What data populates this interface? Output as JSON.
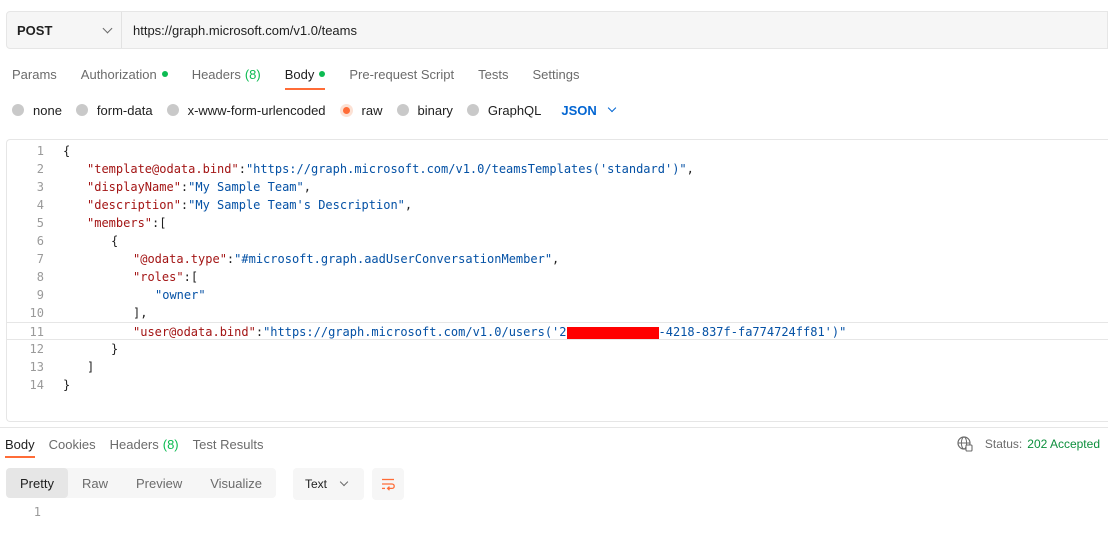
{
  "request": {
    "method": "POST",
    "url": "https://graph.microsoft.com/v1.0/teams"
  },
  "request_tabs": [
    {
      "label": "Params",
      "count": "",
      "dot": false,
      "active": false
    },
    {
      "label": "Authorization",
      "count": "",
      "dot": true,
      "active": false
    },
    {
      "label": "Headers",
      "count": "(8)",
      "dot": false,
      "active": false
    },
    {
      "label": "Body",
      "count": "",
      "dot": true,
      "active": true
    },
    {
      "label": "Pre-request Script",
      "count": "",
      "dot": false,
      "active": false
    },
    {
      "label": "Tests",
      "count": "",
      "dot": false,
      "active": false
    },
    {
      "label": "Settings",
      "count": "",
      "dot": false,
      "active": false
    }
  ],
  "body_types": {
    "options": [
      "none",
      "form-data",
      "x-www-form-urlencoded",
      "raw",
      "binary",
      "GraphQL"
    ],
    "selected": "raw",
    "language": "JSON"
  },
  "editor": {
    "line_numbers": [
      "1",
      "2",
      "3",
      "4",
      "5",
      "6",
      "7",
      "8",
      "9",
      "10",
      "11",
      "12",
      "13",
      "14"
    ],
    "current_line": 11,
    "lines": [
      "{",
      "\"template@odata.bind\":\"https://graph.microsoft.com/v1.0/teamsTemplates('standard')\",",
      "\"displayName\":\"My Sample Team\",",
      "\"description\":\"My Sample Team's Description\",",
      "\"members\":[",
      "{",
      "\"@odata.type\":\"#microsoft.graph.aadUserConversationMember\",",
      "\"roles\":[",
      "\"owner\"",
      "],",
      "\"user@odata.bind\":\"https://graph.microsoft.com/v1.0/users('2",
      "}",
      "]",
      "}"
    ],
    "line11_tail": "-4218-837f-fa774724ff81')\""
  },
  "response": {
    "tabs": [
      {
        "label": "Body",
        "count": "",
        "active": true
      },
      {
        "label": "Cookies",
        "count": "",
        "active": false
      },
      {
        "label": "Headers",
        "count": "(8)",
        "active": false
      },
      {
        "label": "Test Results",
        "count": "",
        "active": false
      }
    ],
    "status_label": "Status:",
    "status_value": "202 Accepted",
    "views": [
      "Pretty",
      "Raw",
      "Preview",
      "Visualize"
    ],
    "active_view": "Pretty",
    "format": "Text",
    "line_numbers": [
      "1"
    ]
  },
  "colors": {
    "accent": "#ff6c37",
    "green": "#0cbb52",
    "link_blue": "#0265d2",
    "json_key": "#a31515",
    "json_string": "#0451a5",
    "redaction": "#ff0000"
  }
}
